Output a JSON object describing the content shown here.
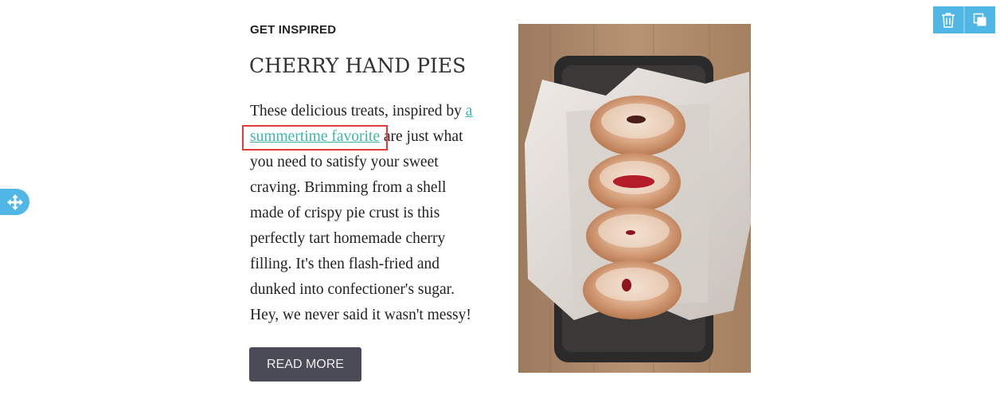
{
  "article": {
    "eyebrow": "GET INSPIRED",
    "title": "CHERRY HAND PIES",
    "body_before_link": "These delicious treats, inspired by ",
    "link_text": "a summertime favorite",
    "body_after_link": " are just what you need to satisfy your sweet craving. Brimming from a shell made of crispy pie crust is this perfectly tart homemade cherry filling. It's then flash-fried and dunked into confectioner's sugar. Hey, we never said it wasn't messy!",
    "cta_label": "READ MORE"
  },
  "image": {
    "subject": "sugar-dusted jelly doughnuts in a paper-lined loaf pan"
  },
  "editor": {
    "drag_icon": "move-arrows-icon",
    "delete_icon": "trash-icon",
    "duplicate_icon": "duplicate-icon"
  },
  "colors": {
    "accent": "#4fb6e6",
    "link": "#3bb5ad",
    "button_bg": "#4a4b56",
    "highlight": "#e23c3c"
  }
}
